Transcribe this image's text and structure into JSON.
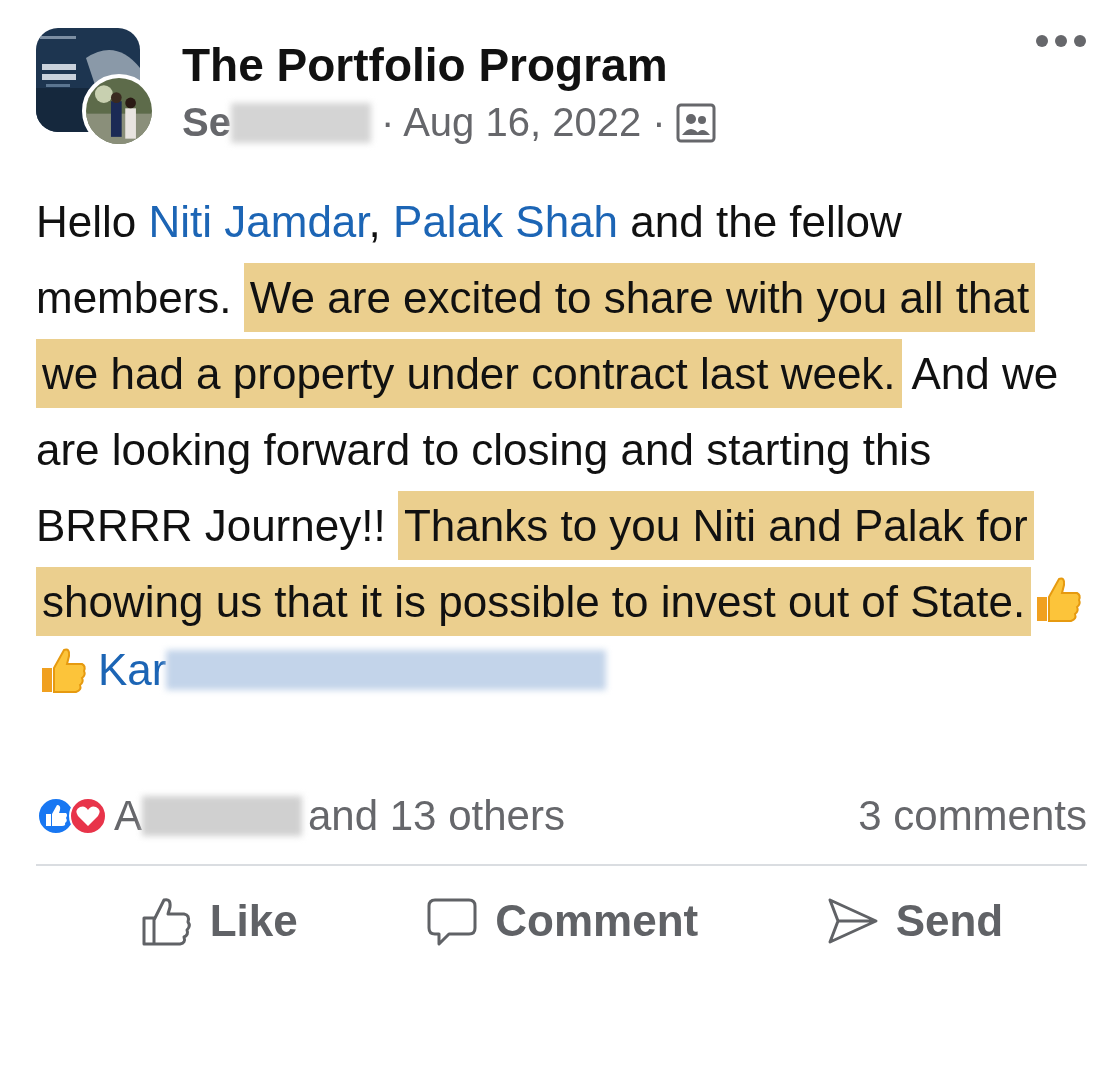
{
  "header": {
    "group_name": "The Portfolio Program",
    "author": "Se",
    "meta": "· Aug 16, 2022 ·"
  },
  "body": {
    "segments": [
      {
        "kind": "text",
        "text": "Hello ",
        "highlighted": false
      },
      {
        "kind": "mention",
        "text": "Niti Jamdar",
        "highlighted": false
      },
      {
        "kind": "text",
        "text": ", ",
        "highlighted": false
      },
      {
        "kind": "mention",
        "text": "Palak Shah",
        "highlighted": false
      },
      {
        "kind": "text",
        "text": " and the fellow members. ",
        "highlighted": false
      },
      {
        "kind": "text",
        "text": "We are excited to share with you all that we had a property under contract last week.",
        "highlighted": true
      },
      {
        "kind": "text",
        "text": " And we are looking forward to closing and starting this BRRRR Journey!! ",
        "highlighted": false
      },
      {
        "kind": "text",
        "text": "Thanks to you Niti and Palak for showing us that it is possible to invest out of State.",
        "highlighted": true
      },
      {
        "kind": "emoji",
        "highlighted": false
      }
    ]
  },
  "tag": {
    "name": "Kar"
  },
  "reactions": {
    "names": "A",
    "others": "and 13 others",
    "comments": "3 comments"
  },
  "actions": [
    {
      "kind": "like",
      "label": "Like"
    },
    {
      "kind": "comment",
      "label": "Comment"
    },
    {
      "kind": "send",
      "label": "Send"
    }
  ]
}
